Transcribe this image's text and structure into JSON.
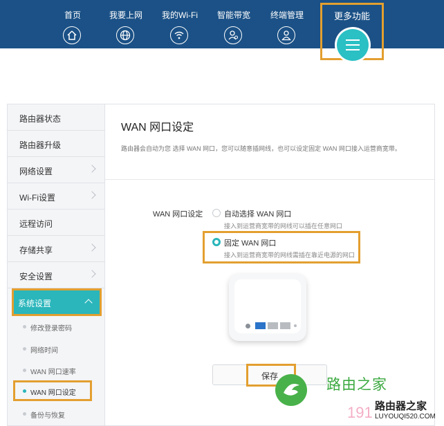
{
  "nav": {
    "items": [
      {
        "label": "首页",
        "icon": "home-icon"
      },
      {
        "label": "我要上网",
        "icon": "globe-icon"
      },
      {
        "label": "我的Wi-Fi",
        "icon": "wifi-icon"
      },
      {
        "label": "智能带宽",
        "icon": "bandwidth-icon"
      },
      {
        "label": "终端管理",
        "icon": "user-icon"
      }
    ],
    "more_label": "更多功能",
    "more_icon": "menu-icon"
  },
  "sidebar": {
    "items": [
      {
        "label": "路由器状态"
      },
      {
        "label": "路由器升级"
      },
      {
        "label": "网络设置"
      },
      {
        "label": "Wi-Fi设置"
      },
      {
        "label": "远程访问"
      },
      {
        "label": "存储共享"
      },
      {
        "label": "安全设置"
      },
      {
        "label": "系统设置"
      }
    ],
    "subitems": [
      {
        "label": "修改登录密码"
      },
      {
        "label": "网络时间"
      },
      {
        "label": "WAN 网口速率"
      },
      {
        "label": "WAN 网口设定"
      },
      {
        "label": "备份与恢复"
      }
    ]
  },
  "main": {
    "title": "WAN 网口设定",
    "description": "路由器会自动为您 选择 WAN 网口，您可以随意插网线，也可以设定固定 WAN 网口接入运营商宽带。",
    "field_label": "WAN 网口设定",
    "options": [
      {
        "title": "自动选择 WAN 网口",
        "sub": "接入到运营商宽带的网线可以插在任意网口",
        "selected": false
      },
      {
        "title": "固定 WAN 网口",
        "sub": "接入到运营商宽带的网线需插在靠近电源的网口",
        "selected": true
      }
    ],
    "save_label": "保存"
  },
  "watermark": {
    "text": "路由之家",
    "number": "191",
    "brand": "路由器之家",
    "url": "LUYOUQI520.COM"
  },
  "colors": {
    "nav_bg": "#1b5186",
    "accent": "#2ab6bb",
    "highlight": "#e39f2f"
  }
}
